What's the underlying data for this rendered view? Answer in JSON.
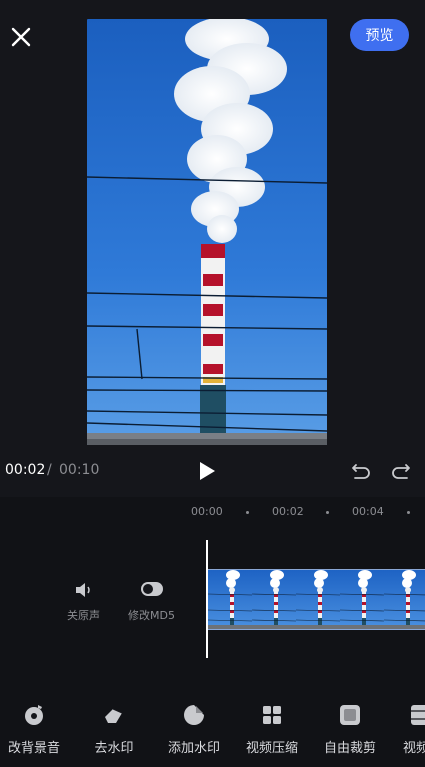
{
  "header": {
    "close_icon": "close-icon",
    "preview_label": "预览",
    "accent_color": "#3f6ff0"
  },
  "player": {
    "current_time": "00:02",
    "separator": "/",
    "total_time": "00:10",
    "play_icon": "play-icon",
    "undo_icon": "undo-icon",
    "redo_icon": "redo-icon"
  },
  "timeline": {
    "ticks": [
      "00:00",
      "00:02",
      "00:04"
    ],
    "mute_label": "关原声",
    "md5_label": "修改MD5",
    "clip_frame_count": 5
  },
  "tools": [
    {
      "label": "改背景音",
      "icon": "music-disc-icon"
    },
    {
      "label": "去水印",
      "icon": "eraser-icon"
    },
    {
      "label": "添加水印",
      "icon": "sticker-icon"
    },
    {
      "label": "视频压缩",
      "icon": "grid-icon"
    },
    {
      "label": "自由裁剪",
      "icon": "crop-icon"
    },
    {
      "label": "视频",
      "icon": "video-icon"
    }
  ]
}
